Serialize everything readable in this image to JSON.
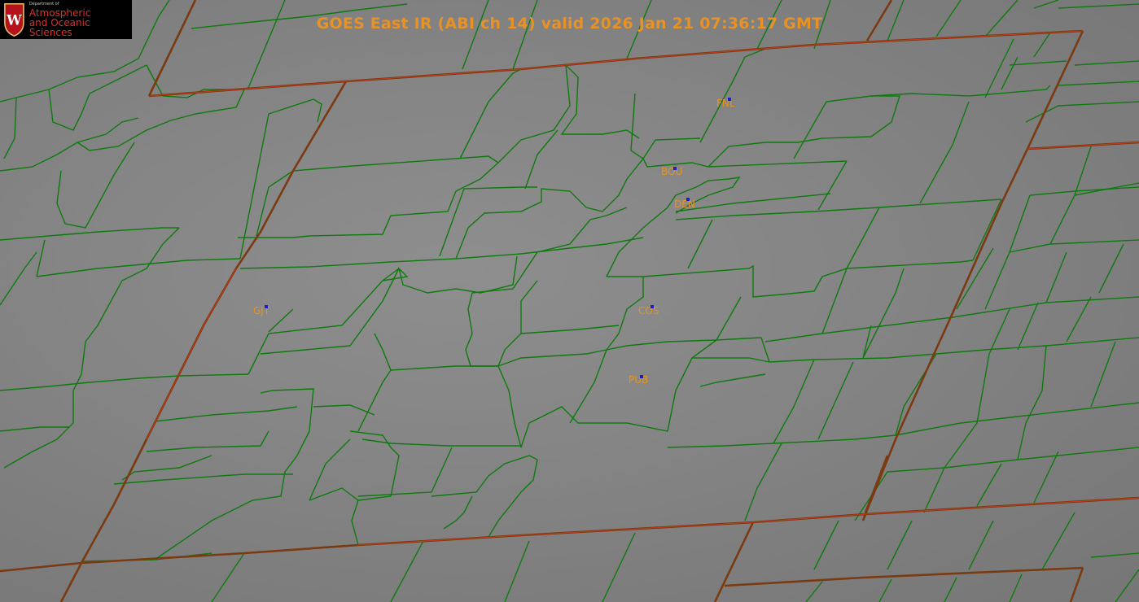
{
  "title": "GOES East IR (ABI ch 14) valid 2026 Jan 21 07:36:17 GMT",
  "logo": {
    "department": "Department of",
    "line1": "Atmospheric",
    "line2": "and Oceanic Sciences",
    "crest_letter": "W"
  },
  "stations": [
    {
      "id": "FNL"
    },
    {
      "id": "BOU"
    },
    {
      "id": "DEN"
    },
    {
      "id": "GJT"
    },
    {
      "id": "COS"
    },
    {
      "id": "PUB"
    }
  ],
  "colors": {
    "title": "#e89226",
    "station_label": "#e6941f",
    "county_lines": "#0f7a0f",
    "state_lines": "#7a3a12",
    "logo_text": "#d8322a",
    "station_marker": "#1d1dcc"
  }
}
